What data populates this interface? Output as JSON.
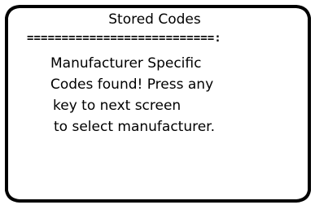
{
  "screen": {
    "title": "Stored Codes",
    "separator": "===========================:",
    "message_lines": [
      "Manufacturer Specific",
      "Codes found! Press any",
      "key to next screen",
      "to select manufacturer."
    ]
  },
  "colors": {
    "background": "#ffffff",
    "border": "#000000",
    "text": "#000000"
  }
}
